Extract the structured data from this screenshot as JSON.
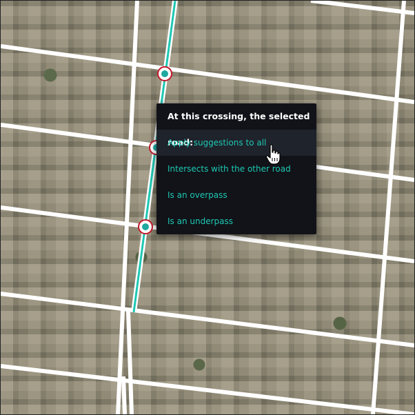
{
  "colors": {
    "road": "#ffffff",
    "selected_road": "#1ec8b4",
    "node_outline": "#c0182a",
    "menu_bg": "#111318",
    "menu_highlight": "#1f232b",
    "menu_text_accent": "#1ec8b4"
  },
  "context_menu": {
    "header": "At this crossing, the selected road:",
    "items": [
      {
        "label": "Apply suggestions to all"
      },
      {
        "label": "Intersects with the other road"
      },
      {
        "label": "Is an overpass"
      },
      {
        "label": "Is an underpass"
      }
    ]
  },
  "icons": {
    "pointer": "hand-pointer-icon",
    "crossing_marker": "crossing-node-icon"
  }
}
